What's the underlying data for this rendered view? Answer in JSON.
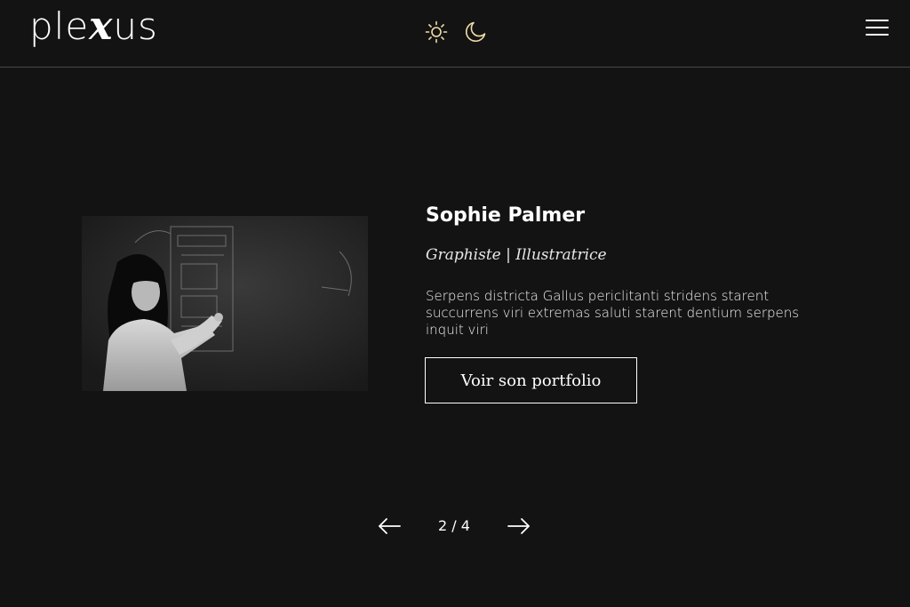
{
  "header": {
    "logo": {
      "part1": "ple",
      "part2": "x",
      "part3": "us"
    },
    "icons": [
      "sun-icon",
      "moon-icon",
      "hamburger-menu-icon"
    ]
  },
  "profile": {
    "name": "Sophie Palmer",
    "role": "Graphiste | Illustratrice",
    "bio": "Serpens districta Gallus periclitanti stridens starent succurrens viri extremas saluti starent dentium serpens inquit viri",
    "cta_label": "Voir son portfolio",
    "photo": "black-and-white photo of woman drawing on chalkboard"
  },
  "pagination": {
    "counter": "2 / 4",
    "icons": [
      "arrow-left-icon",
      "arrow-right-icon"
    ]
  },
  "colors": {
    "background": "#141314",
    "text": "#ffffff",
    "divider": "#4a494a"
  }
}
